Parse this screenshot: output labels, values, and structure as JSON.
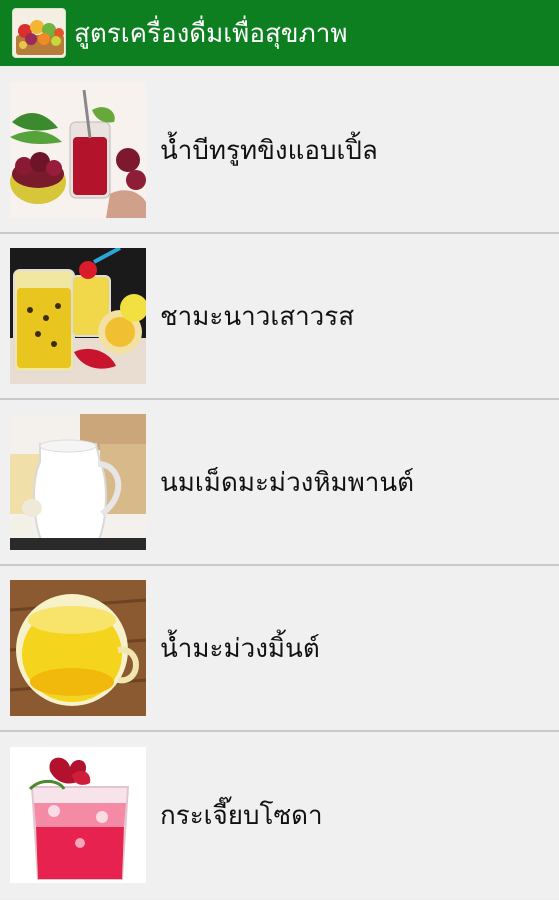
{
  "app": {
    "title": "สูตรเครื่องดื่มเพื่อสุขภาพ",
    "icon": "fruit-basket-icon",
    "bar_color": "#0e7f20"
  },
  "drinks": [
    {
      "label": "น้ำบีทรูทขิงแอบเปิ้ล",
      "image": "beetroot-apple-juice-image"
    },
    {
      "label": "ชามะนาวเสาวรส",
      "image": "passion-fruit-lemon-tea-image"
    },
    {
      "label": "นมเม็ดมะม่วงหิมพานต์",
      "image": "cashew-milk-image"
    },
    {
      "label": "น้ำมะม่วงมิ้นต์",
      "image": "mango-mint-juice-image"
    },
    {
      "label": "กระเจี๊ยบโซดา",
      "image": "roselle-soda-image"
    }
  ]
}
